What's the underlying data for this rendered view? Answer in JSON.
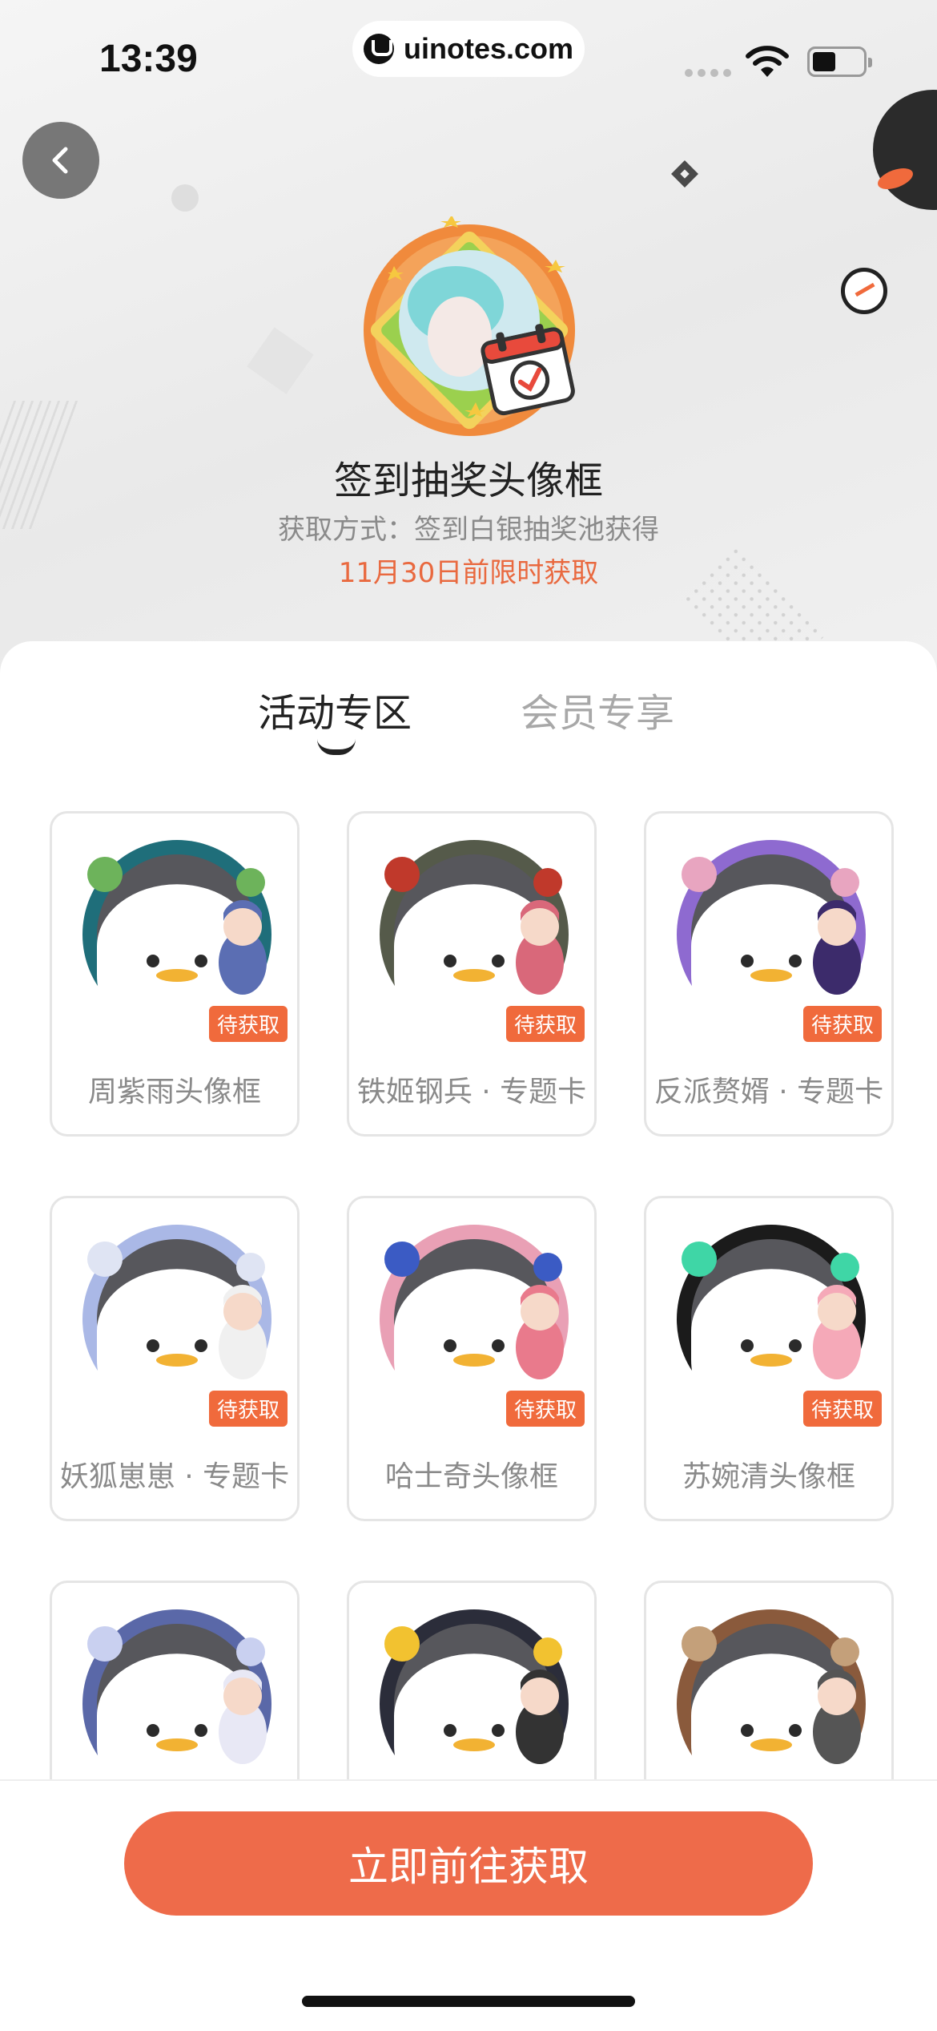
{
  "status_bar": {
    "time": "13:39",
    "url": "uinotes.com"
  },
  "featured": {
    "title": "签到抽奖头像框",
    "source": "获取方式：签到白银抽奖池获得",
    "limit": "11月30日前限时获取"
  },
  "tabs": [
    {
      "label": "活动专区",
      "active": true
    },
    {
      "label": "会员专享",
      "active": false
    }
  ],
  "items": [
    {
      "name": "周紫雨头像框",
      "badge": "待获取",
      "ring": "#1f6e7a",
      "accent": "#6db35b",
      "char": "#5b6eb3"
    },
    {
      "name": "铁姬钢兵 · 专题卡",
      "badge": "待获取",
      "ring": "#555a4a",
      "accent": "#c0392b",
      "char": "#d9687a"
    },
    {
      "name": "反派赘婿 · 专题卡",
      "badge": "待获取",
      "ring": "#8e6ad0",
      "accent": "#e8a5c0",
      "char": "#3c2b6b"
    },
    {
      "name": "妖狐崽崽 · 专题卡",
      "badge": "待获取",
      "ring": "#aab8e6",
      "accent": "#dfe4f3",
      "char": "#f0f0f0"
    },
    {
      "name": "哈士奇头像框",
      "badge": "待获取",
      "ring": "#e9a0b5",
      "accent": "#3b5bc4",
      "char": "#e97a8c"
    },
    {
      "name": "苏婉清头像框",
      "badge": "待获取",
      "ring": "#1b1b1b",
      "accent": "#3fd6a6",
      "char": "#f5a9b8"
    },
    {
      "name": "",
      "badge": "",
      "ring": "#5a68a8",
      "accent": "#c9d0f0",
      "char": "#e8e8f5"
    },
    {
      "name": "",
      "badge": "",
      "ring": "#2b2d3a",
      "accent": "#f2c230",
      "char": "#333333"
    },
    {
      "name": "",
      "badge": "",
      "ring": "#8a5a3c",
      "accent": "#c4a07a",
      "char": "#555555"
    }
  ],
  "cta": {
    "label": "立即前往获取"
  },
  "colors": {
    "accent": "#ee6b4a",
    "badge": "#f06a3c"
  }
}
